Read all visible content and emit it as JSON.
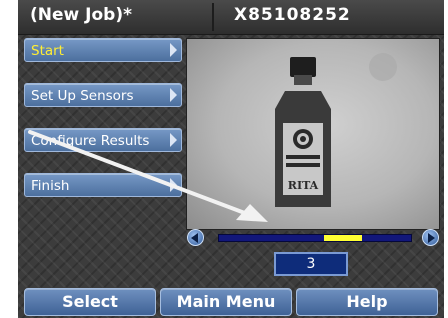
{
  "header": {
    "job_title": "(New Job)*",
    "serial": "X85108252"
  },
  "sidebar": {
    "items": [
      {
        "label": "Start",
        "active": true
      },
      {
        "label": "Set Up Sensors",
        "active": false
      },
      {
        "label": "Configure Results",
        "active": false
      },
      {
        "label": "Finish",
        "active": false
      }
    ]
  },
  "viewer": {
    "bottle_label_text": "RITA",
    "scroll_position": 0.55,
    "frame_number": "3"
  },
  "softkeys": {
    "select": "Select",
    "main_menu": "Main Menu",
    "help": "Help"
  },
  "colors": {
    "menu_active_text": "#ffee33",
    "track": "#12177a",
    "thumb": "#ffff33"
  }
}
